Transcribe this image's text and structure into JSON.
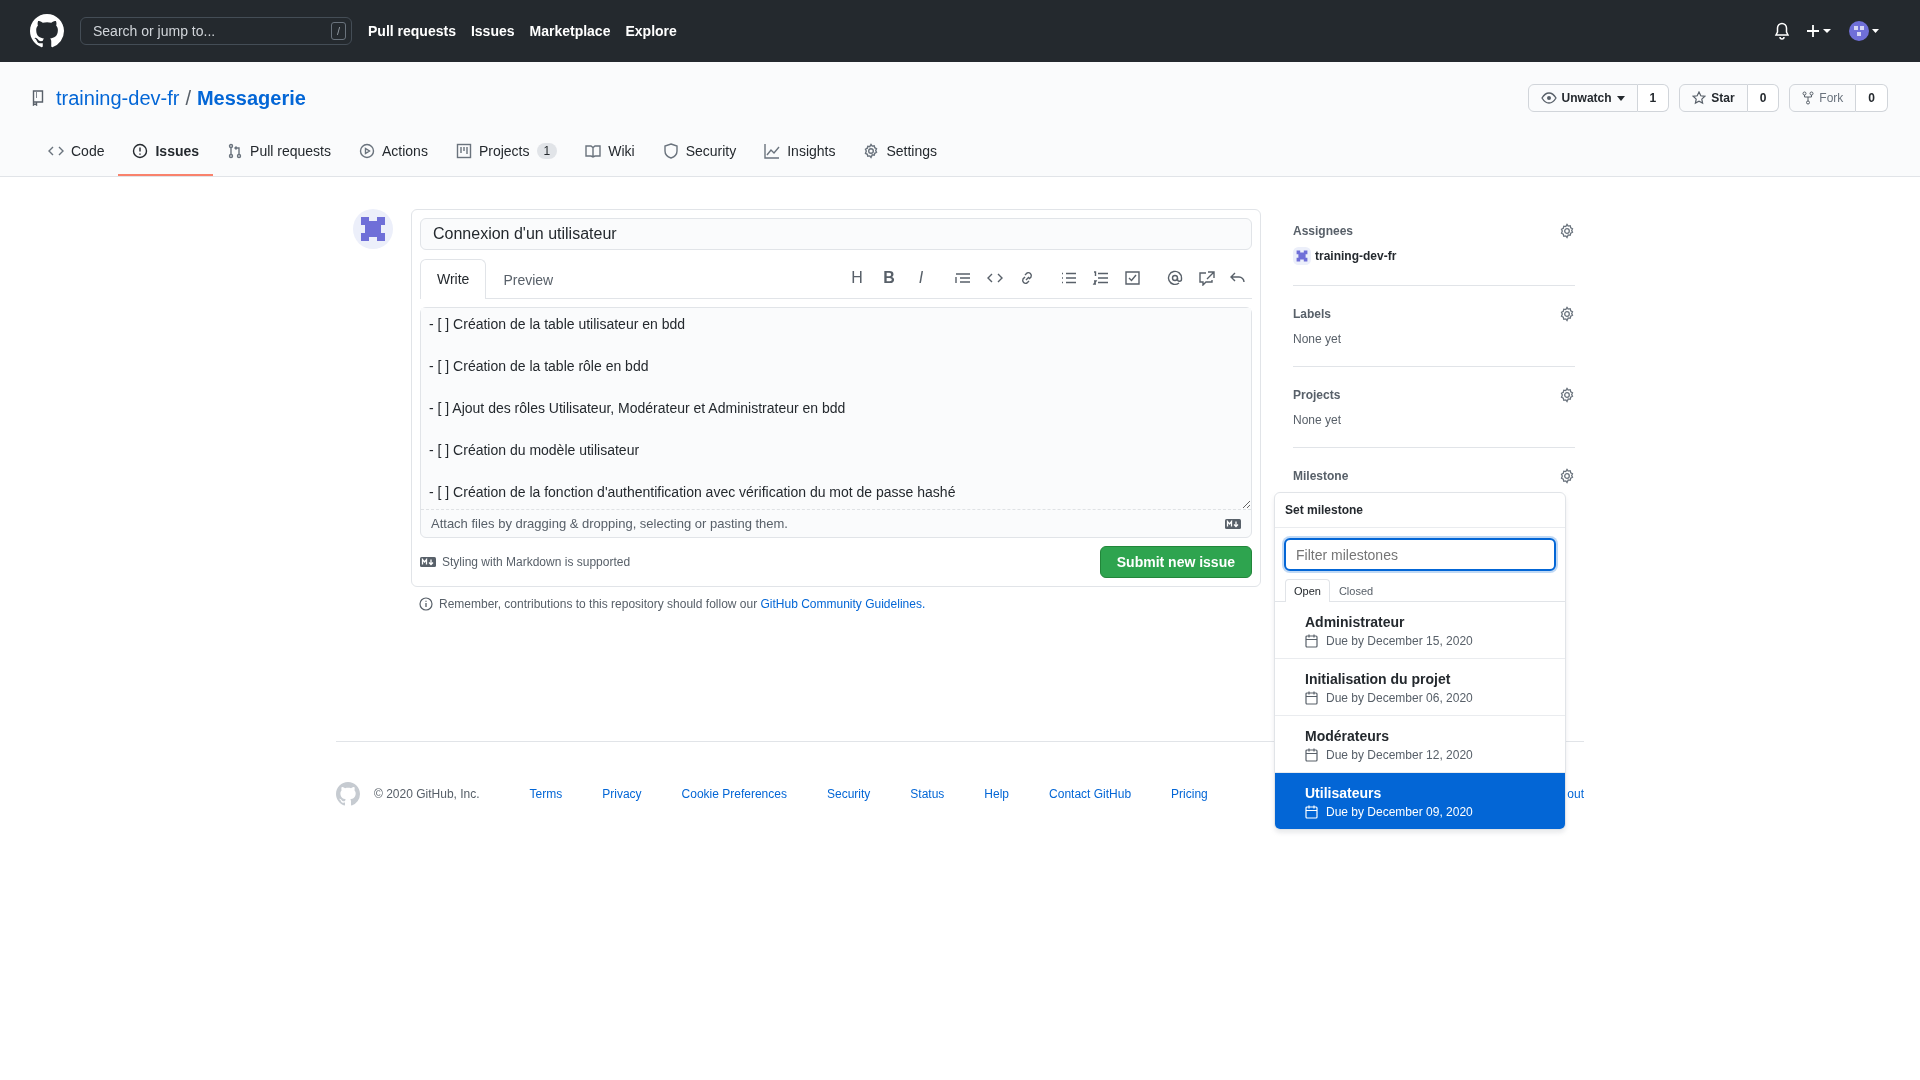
{
  "top_nav": {
    "search_placeholder": "Search or jump to...",
    "search_key": "/",
    "links": [
      "Pull requests",
      "Issues",
      "Marketplace",
      "Explore"
    ]
  },
  "repo": {
    "owner": "training-dev-fr",
    "separator": "/",
    "name": "Messagerie",
    "actions": [
      {
        "label": "Unwatch",
        "count": "1",
        "kind": "watch"
      },
      {
        "label": "Star",
        "count": "0",
        "kind": "star"
      },
      {
        "label": "Fork",
        "count": "0",
        "kind": "fork"
      }
    ]
  },
  "tabs": [
    {
      "label": "Code",
      "kind": "code",
      "selected": false
    },
    {
      "label": "Issues",
      "kind": "issues",
      "selected": true
    },
    {
      "label": "Pull requests",
      "kind": "pulls",
      "selected": false
    },
    {
      "label": "Actions",
      "kind": "actions",
      "selected": false
    },
    {
      "label": "Projects",
      "kind": "projects",
      "counter": "1",
      "selected": false
    },
    {
      "label": "Wiki",
      "kind": "wiki",
      "selected": false
    },
    {
      "label": "Security",
      "kind": "security",
      "selected": false
    },
    {
      "label": "Insights",
      "kind": "insights",
      "selected": false
    },
    {
      "label": "Settings",
      "kind": "settings",
      "selected": false
    }
  ],
  "issue_form": {
    "title_value": "Connexion d'un utilisateur",
    "editor_tabs": [
      {
        "label": "Write",
        "selected": true
      },
      {
        "label": "Preview",
        "selected": false
      }
    ],
    "toolbar": [
      {
        "kind": "heading",
        "label": "H"
      },
      {
        "kind": "bold",
        "label": "B"
      },
      {
        "kind": "italic",
        "label": "I"
      },
      {
        "kind": "quote"
      },
      {
        "kind": "code"
      },
      {
        "kind": "link"
      },
      {
        "kind": "ul"
      },
      {
        "kind": "ol"
      },
      {
        "kind": "task"
      },
      {
        "kind": "mention"
      },
      {
        "kind": "reference"
      },
      {
        "kind": "reply"
      }
    ],
    "body_lines": [
      "- [ ] Création de la table utilisateur en bdd",
      "- [ ] Création de la table rôle en bdd",
      "- [ ] Ajout des rôles Utilisateur, Modérateur et Administrateur en bdd",
      "- [ ] Création du modèle utilisateur",
      "- [ ] Création de la fonction d'authentification avec vérification du mot de passe hashé"
    ],
    "attach_hint": "Attach files by dragging & dropping, selecting or pasting them.",
    "markdown_note": "Styling with Markdown is supported",
    "submit": "Submit new issue",
    "guidelines_note": "Remember, contributions to this repository should follow our",
    "guidelines_link": "GitHub Community Guidelines."
  },
  "sidebar": [
    {
      "title": "Assignees",
      "kind": "user",
      "value": "training-dev-fr"
    },
    {
      "title": "Labels",
      "kind": "text",
      "value": "None yet"
    },
    {
      "title": "Projects",
      "kind": "text",
      "value": "None yet"
    },
    {
      "title": "Milestone",
      "kind": "menu"
    }
  ],
  "milestone_menu": {
    "title": "Set milestone",
    "filter_placeholder": "Filter milestones",
    "tabs": [
      {
        "label": "Open",
        "selected": true
      },
      {
        "label": "Closed",
        "selected": false
      }
    ],
    "items": [
      {
        "name": "Administrateur",
        "due": "Due by December 15, 2020",
        "selected": false
      },
      {
        "name": "Initialisation du projet",
        "due": "Due by December 06, 2020",
        "selected": false
      },
      {
        "name": "Modérateurs",
        "due": "Due by December 12, 2020",
        "selected": false
      },
      {
        "name": "Utilisateurs",
        "due": "Due by December 09, 2020",
        "selected": true
      }
    ]
  },
  "footer": {
    "copyright": "© 2020 GitHub, Inc.",
    "links": [
      "Terms",
      "Privacy",
      "Cookie Preferences",
      "Security",
      "Status",
      "Help",
      "Contact GitHub",
      "Pricing"
    ],
    "cut_fragment": "out"
  }
}
